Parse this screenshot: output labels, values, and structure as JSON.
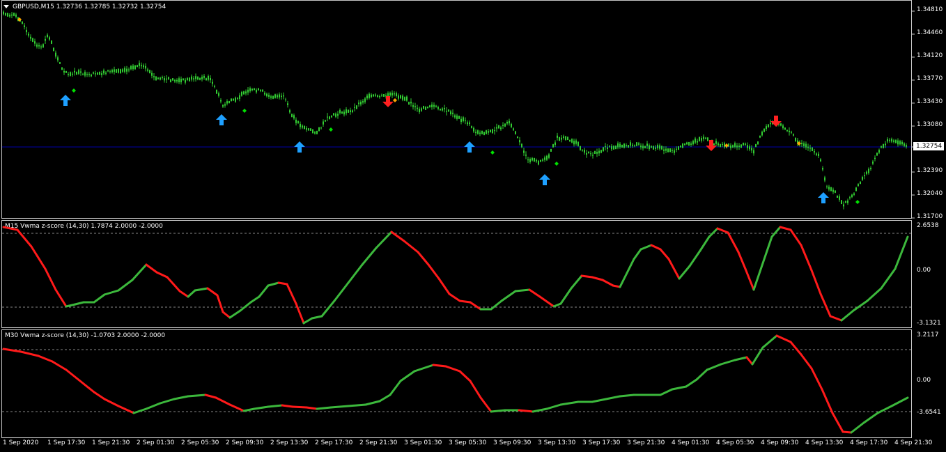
{
  "main": {
    "dropdown_icon": "triangle-down-icon",
    "symbol_info": "GBPUSD,M15  1.32736 1.32785 1.32732 1.32754",
    "price_axis": [
      "1.34810",
      "1.34460",
      "1.34120",
      "1.33770",
      "1.33430",
      "1.33080",
      "1.32754",
      "1.32390",
      "1.32040",
      "1.31700"
    ],
    "current_price": "1.32754",
    "colors": {
      "bull": "#32cd32",
      "bear": "#32cd32",
      "buy_arrow": "#1ea0ff",
      "sell_arrow": "#ff2020",
      "green_dot": "#00e000",
      "orange_dot": "#ffa500",
      "price_line": "#0000aa"
    }
  },
  "m15": {
    "label": "M15 Vwma z-score (14,30) 1.7874 2.0000 -2.0000",
    "axis_top": "2.6538",
    "axis_mid": "0.00",
    "axis_bottom": "-3.1321"
  },
  "m30": {
    "label": "M30 Vwma z-score (14,30) -1.0703 2.0000 -2.0000",
    "axis_top": "3.2117",
    "axis_mid": "0.00",
    "axis_bottom": "-3.6541"
  },
  "time_axis": [
    "1 Sep 2020",
    "1 Sep 17:30",
    "1 Sep 21:30",
    "2 Sep 01:30",
    "2 Sep 05:30",
    "2 Sep 09:30",
    "2 Sep 13:30",
    "2 Sep 17:30",
    "2 Sep 21:30",
    "3 Sep 01:30",
    "3 Sep 05:30",
    "3 Sep 09:30",
    "3 Sep 13:30",
    "3 Sep 17:30",
    "3 Sep 21:30",
    "4 Sep 01:30",
    "4 Sep 05:30",
    "4 Sep 09:30",
    "4 Sep 13:30",
    "4 Sep 17:30",
    "4 Sep 21:30"
  ]
}
